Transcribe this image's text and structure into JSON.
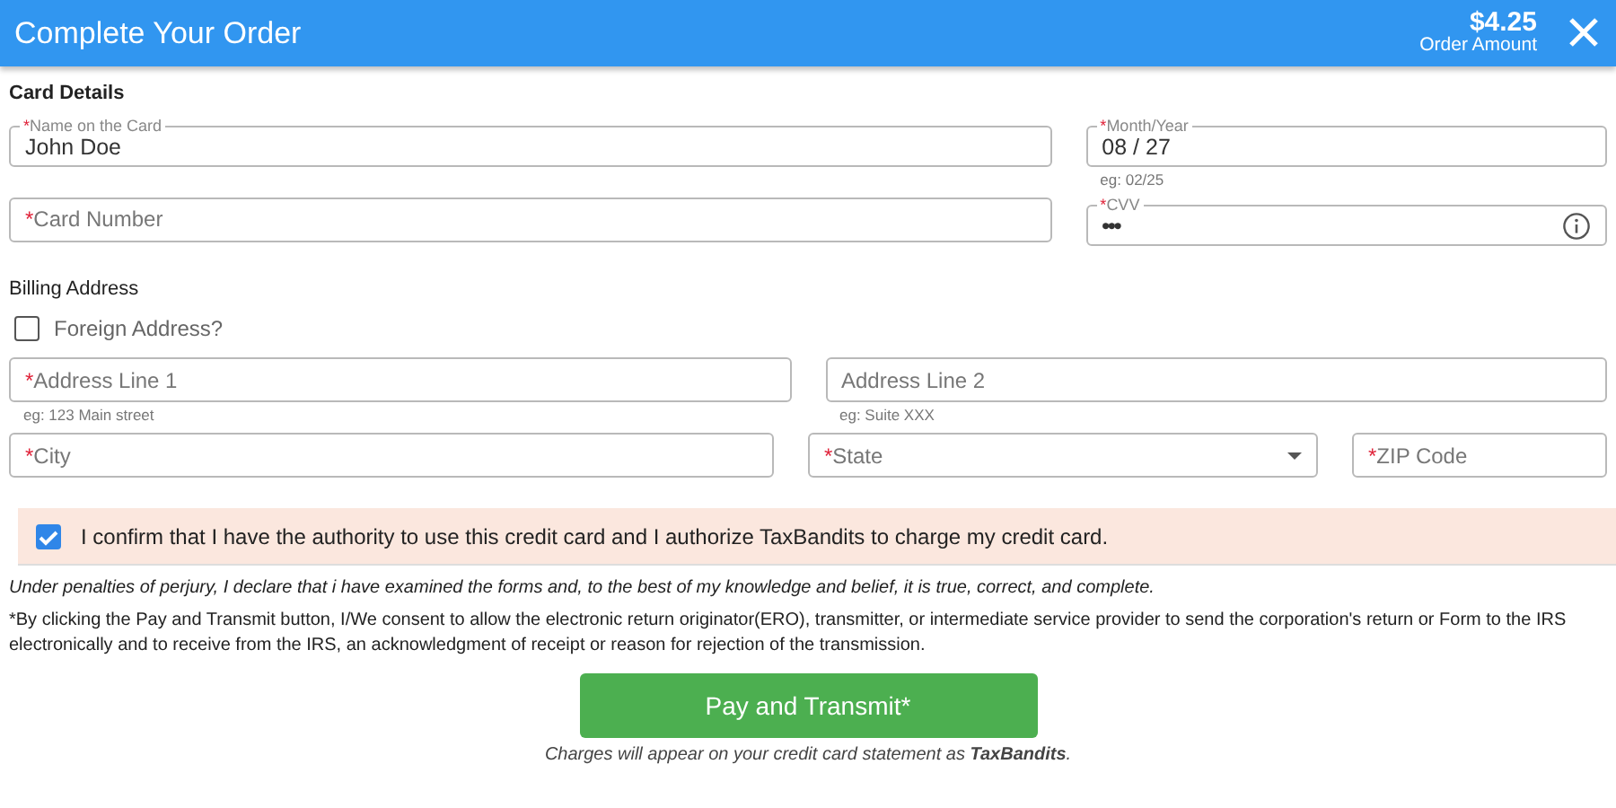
{
  "header": {
    "title": "Complete Your Order",
    "amount": "$4.25",
    "amount_label": "Order Amount"
  },
  "required_mark": "*",
  "card_details": {
    "heading": "Card Details",
    "rows": [
      [
        {
          "kind": "text",
          "label": "Name on the Card",
          "required": true,
          "value": "John Doe"
        },
        {
          "kind": "text",
          "label": "Month/Year",
          "required": true,
          "value": "08 / 27",
          "hint": "eg: 02/25"
        }
      ],
      [
        {
          "kind": "text",
          "label": "Card Number",
          "required": true
        },
        {
          "kind": "secret",
          "label": "CVV",
          "required": true,
          "value": "•••"
        }
      ]
    ]
  },
  "billing": {
    "heading": "Billing Address",
    "foreign": {
      "label": "Foreign Address?",
      "checked": false
    },
    "rows": [
      [
        {
          "kind": "text",
          "label": "Address Line 1",
          "required": true,
          "hint": "eg: 123 Main street"
        },
        {
          "kind": "text",
          "label": "Address Line 2",
          "required": false,
          "hint": "eg: Suite XXX"
        }
      ],
      [
        {
          "kind": "text",
          "label": "City",
          "required": true
        },
        {
          "kind": "select",
          "label": "State",
          "required": true
        },
        {
          "kind": "text",
          "label": "ZIP Code",
          "required": true
        }
      ]
    ]
  },
  "confirm": {
    "label": "I confirm that I have the authority to use this credit card and I authorize TaxBandits to charge my credit card.",
    "checked": true
  },
  "perjury": "Under penalties of perjury, I declare that i have examined the forms and, to the best of my knowledge and belief, it is true, correct, and complete.",
  "consent": "*By clicking the Pay and Transmit button, I/We consent to allow the electronic return originator(ERO), transmitter, or intermediate service provider to send the corporation's return or Form to the IRS electronically and to receive from the IRS, an acknowledgment of receipt or reason for rejection of the transmission.",
  "pay_button": "Pay and Transmit*",
  "charges_note": "Charges will appear on your credit card statement as **TaxBandits**."
}
